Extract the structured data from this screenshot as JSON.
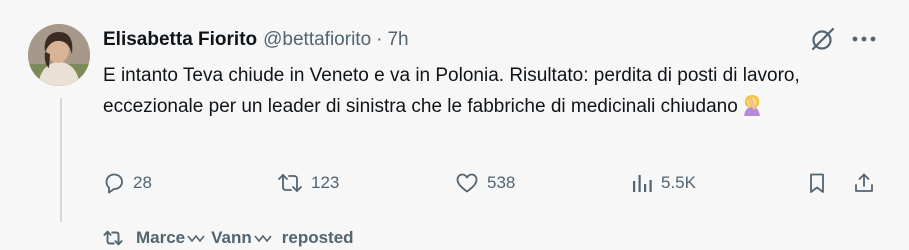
{
  "tweet": {
    "display_name": "Elisabetta Fiorito",
    "handle": "@bettafiorito",
    "separator": "·",
    "time": "7h",
    "text": "E intanto Teva chiude in Veneto e va in Polonia. Risultato: perdita di posti di lavoro, eccezionale per un leader di sinistra che le fabbriche di medicinali chiudano",
    "emoji": "woman-facepalming-emoji",
    "icons": {
      "grok": "grok-icon",
      "more": "more-icon"
    }
  },
  "actions": {
    "reply": {
      "icon": "reply-icon",
      "count": "28"
    },
    "repost": {
      "icon": "repost-icon",
      "count": "123"
    },
    "like": {
      "icon": "like-icon",
      "count": "538"
    },
    "views": {
      "icon": "views-icon",
      "count": "5.5K"
    },
    "bookmark": {
      "icon": "bookmark-icon"
    },
    "share": {
      "icon": "share-icon"
    }
  },
  "repost_bar": {
    "name_part1": "Marce",
    "name_part2": "Vann",
    "suffix": "reposted",
    "icon": "repost-icon"
  },
  "colors": {
    "background": "#f7f7f7",
    "text_primary": "#0f1419",
    "text_secondary": "#536471",
    "thread_line": "#cfd9de"
  }
}
